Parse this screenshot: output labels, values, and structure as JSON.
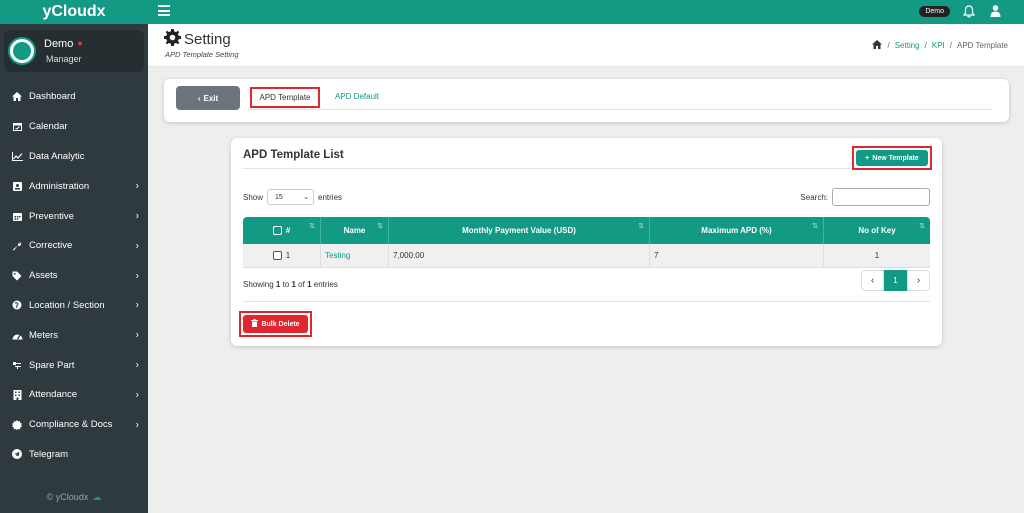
{
  "app": {
    "brand": "yCloudx"
  },
  "user": {
    "name": "Demo",
    "role": "Manager",
    "badge": "Demo"
  },
  "sidebar": {
    "items": [
      {
        "label": "Dashboard",
        "icon": "home-icon",
        "has_arrow": false
      },
      {
        "label": "Calendar",
        "icon": "calendar-icon",
        "has_arrow": false
      },
      {
        "label": "Data Analytic",
        "icon": "chart-icon",
        "has_arrow": false
      },
      {
        "label": "Administration",
        "icon": "id-card-icon",
        "has_arrow": true
      },
      {
        "label": "Preventive",
        "icon": "calendar-grid-icon",
        "has_arrow": true
      },
      {
        "label": "Corrective",
        "icon": "wrench-icon",
        "has_arrow": true
      },
      {
        "label": "Assets",
        "icon": "tag-icon",
        "has_arrow": true
      },
      {
        "label": "Location / Section",
        "icon": "globe-icon",
        "has_arrow": true
      },
      {
        "label": "Meters",
        "icon": "gauge-icon",
        "has_arrow": true
      },
      {
        "label": "Spare Part",
        "icon": "tools-icon",
        "has_arrow": true
      },
      {
        "label": "Attendance",
        "icon": "building-icon",
        "has_arrow": true
      },
      {
        "label": "Compliance & Docs",
        "icon": "certificate-icon",
        "has_arrow": true
      },
      {
        "label": "Telegram",
        "icon": "telegram-icon",
        "has_arrow": false
      }
    ],
    "footer": "© yCloudx"
  },
  "header": {
    "title": "Setting",
    "subtitle": "APD Template Setting",
    "breadcrumb": {
      "setting": "Setting",
      "kpi": "KPI",
      "current": "APD Template"
    }
  },
  "tabs": {
    "exit_label": "Exit",
    "active": "APD Template",
    "second": "APD Default"
  },
  "list": {
    "title": "APD Template List",
    "new_button": "New Template",
    "show_label": "Show",
    "entries_value": "15",
    "entries_label": "entries",
    "search_label": "Search:",
    "columns": [
      "#",
      "Name",
      "Monthly Payment Value (USD)",
      "Maximum APD (%)",
      "No of Key"
    ],
    "rows": [
      {
        "no": "1",
        "name": "Testing",
        "monthly": "7,000.00",
        "max_apd": "7",
        "keys": "1"
      }
    ],
    "showing": {
      "prefix": "Showing ",
      "from": "1",
      "to_word": " to ",
      "to": "1",
      "of_word": " of ",
      "total": "1",
      "suffix": " entries"
    },
    "page": "1",
    "bulk_delete": "Bulk Delete"
  },
  "colors": {
    "accent": "#139a85",
    "danger": "#e0262f",
    "sidebar": "#2f3a3e",
    "exit": "#6c757d"
  }
}
